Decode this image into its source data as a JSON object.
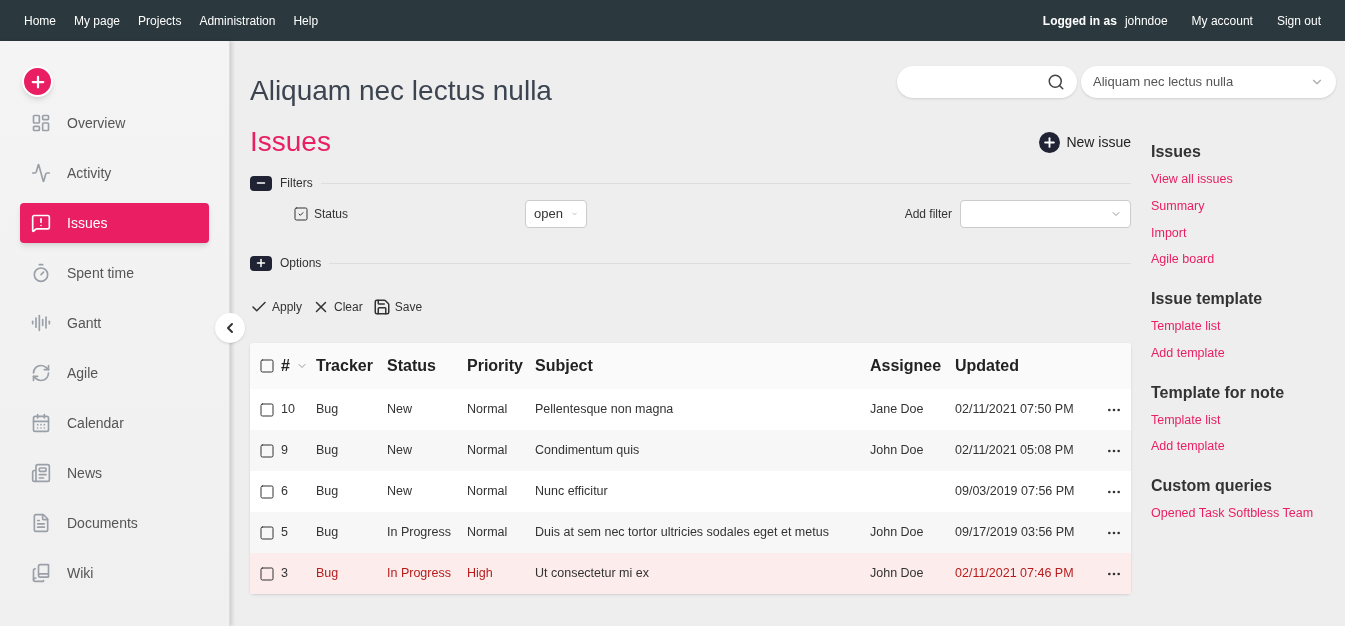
{
  "top_menu": [
    "Home",
    "My page",
    "Projects",
    "Administration",
    "Help"
  ],
  "account": {
    "logged_in_label": "Logged in as",
    "user": "johndoe",
    "links": [
      "My account",
      "Sign out"
    ]
  },
  "sidebar": {
    "items": [
      {
        "label": "Overview",
        "selected": false
      },
      {
        "label": "Activity",
        "selected": false
      },
      {
        "label": "Issues",
        "selected": true
      },
      {
        "label": "Spent time",
        "selected": false
      },
      {
        "label": "Gantt",
        "selected": false
      },
      {
        "label": "Agile",
        "selected": false
      },
      {
        "label": "Calendar",
        "selected": false
      },
      {
        "label": "News",
        "selected": false
      },
      {
        "label": "Documents",
        "selected": false
      },
      {
        "label": "Wiki",
        "selected": false
      }
    ]
  },
  "project_title": "Aliquam nec lectus nulla",
  "project_select": {
    "value": "Aliquam nec lectus nulla"
  },
  "page_title": "Issues",
  "new_issue": "New issue",
  "filters": {
    "label": "Filters",
    "expanded": true,
    "rows": [
      {
        "label": "Status",
        "checked": true,
        "operator": "open"
      }
    ],
    "add_filter_label": "Add filter"
  },
  "options": {
    "label": "Options",
    "expanded": false
  },
  "actions": [
    "Apply",
    "Clear",
    "Save"
  ],
  "table": {
    "all_checked": false,
    "columns": [
      "#",
      "Tracker",
      "Status",
      "Priority",
      "Subject",
      "Assignee",
      "Updated"
    ],
    "rows": [
      {
        "checked": false,
        "highlighted": false,
        "cells": [
          "10",
          "Bug",
          "New",
          "Normal",
          "Pellentesque non magna",
          "Jane Doe",
          "02/11/2021 07:50 PM"
        ]
      },
      {
        "checked": false,
        "highlighted": false,
        "cells": [
          "9",
          "Bug",
          "New",
          "Normal",
          "Condimentum quis",
          "John Doe",
          "02/11/2021 05:08 PM"
        ]
      },
      {
        "checked": false,
        "highlighted": false,
        "cells": [
          "6",
          "Bug",
          "New",
          "Normal",
          "Nunc efficitur",
          "",
          "09/03/2019 07:56 PM"
        ]
      },
      {
        "checked": false,
        "highlighted": false,
        "cells": [
          "5",
          "Bug",
          "In Progress",
          "Normal",
          "Duis at sem nec tortor ultricies sodales eget et metus",
          "John Doe",
          "09/17/2019 03:56 PM"
        ]
      },
      {
        "checked": false,
        "highlighted": true,
        "cells": [
          "3",
          "Bug",
          "In Progress",
          "High",
          "Ut consectetur mi ex",
          "John Doe",
          "02/11/2021 07:46 PM"
        ]
      }
    ]
  },
  "right_sidebar": [
    {
      "title": "Issues",
      "links": [
        "View all issues",
        "Summary",
        "Import",
        "Agile board"
      ]
    },
    {
      "title": "Issue template",
      "links": [
        "Template list",
        "Add template"
      ]
    },
    {
      "title": "Template for note",
      "links": [
        "Template list",
        "Add template"
      ]
    },
    {
      "title": "Custom queries",
      "links": [
        "Opened Task Softbless Team"
      ]
    }
  ]
}
